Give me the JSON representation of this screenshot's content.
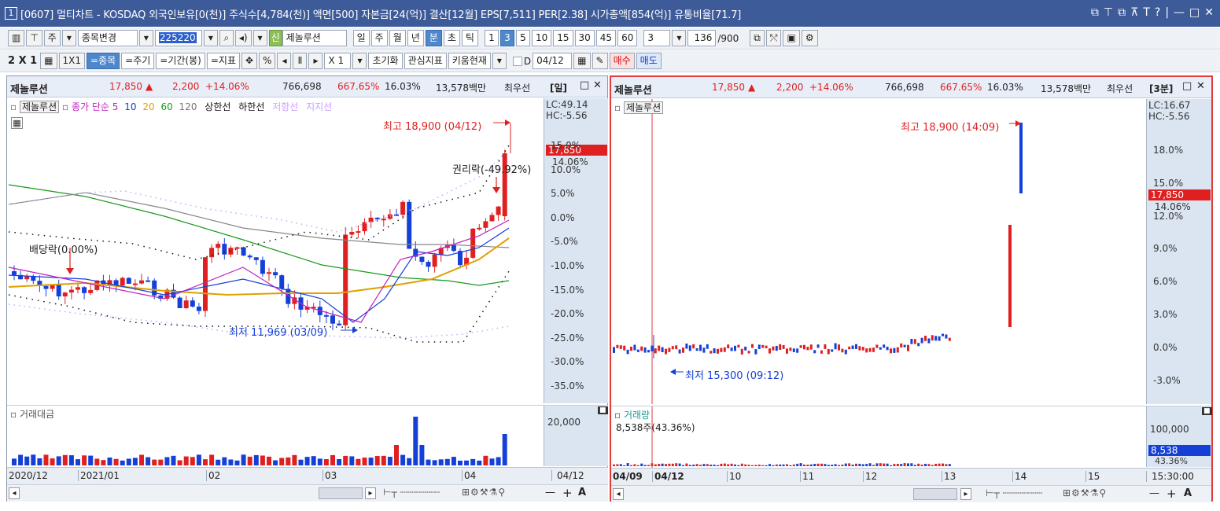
{
  "window": {
    "num": "1",
    "title": "[0607] 멀티차트 - KOSDAQ 외국인보유[0(천)] 주식수[4,784(천)] 액면[500] 자본금[24(억)] 결산[12월] EPS[7,511] PER[2.38] 시가총액[854(억)] 유통비율[71.7]",
    "controls": [
      "⧉",
      "⊤",
      "⧉",
      "⊼",
      "T",
      "?",
      "|",
      "—",
      "□",
      "✕"
    ]
  },
  "toolbar1": {
    "kind": "주",
    "change": "종목변경",
    "code": "225220",
    "stock_tag": "신",
    "stock_name": "제놀루션",
    "periods": [
      "일",
      "주",
      "월",
      "년",
      "분",
      "초",
      "틱"
    ],
    "period_selected": "분",
    "intervals": [
      "1",
      "3",
      "5",
      "10",
      "15",
      "30",
      "45",
      "60"
    ],
    "interval_selected": "3",
    "count_select": "3",
    "range": "136",
    "range_total": "/900"
  },
  "toolbar2": {
    "grid": "2 X 1",
    "one": "1X1",
    "tabs": [
      "=종목",
      "=주기",
      "=기간(봉)",
      "=지표"
    ],
    "tab_selected": "=종목",
    "pct": "%",
    "mult": "X 1",
    "reset": "초기화",
    "watch": "관심지표",
    "kiwoom": "키움현재",
    "d": "D",
    "date": "04/12",
    "buy": "매수",
    "sell": "매도"
  },
  "colors": {
    "up": "#e02020",
    "down": "#1540d8",
    "accent": "#4e87cc"
  },
  "left": {
    "header": {
      "name": "제놀루션",
      "price": "17,850",
      "arrow": "▲",
      "change": "2,200",
      "pct": "+14.06%",
      "volume": "766,698",
      "vol_pct": "667.65%",
      "rate": "16.03%",
      "amount": "13,578백만",
      "ask": "최우선",
      "period": "[일]"
    },
    "legend": {
      "name": "제놀루션",
      "ma": "종가 단순",
      "p5": "5",
      "p10": "10",
      "p20": "20",
      "p60": "60",
      "p120": "120",
      "upper": "상한선",
      "lower": "하한선",
      "resist": "저항선",
      "support": "지지선"
    },
    "lc": "LC:49.14",
    "hc": "HC:-5.56",
    "yticks": [
      "15.0%",
      "10.0%",
      "5.0%",
      "0.0%",
      "-5.0%",
      "-10.0%",
      "-15.0%",
      "-20.0%",
      "-25.0%",
      "-30.0%",
      "-35.0%"
    ],
    "price_tag": "17,850",
    "pct_tag": "14.06%",
    "ann_high": "최고 18,900 (04/12)",
    "ann_low": "최저 11,969 (03/09)",
    "ann_div": "배당락(0.00%)",
    "ann_right": "권리락(-49.92%)",
    "vol_title": "거래대금",
    "vol_ytick": "20,000",
    "xlabels": [
      "2020/12",
      "2021/01",
      "02",
      "03",
      "04"
    ],
    "xright": "04/12"
  },
  "right": {
    "header": {
      "name": "제놀루션",
      "price": "17,850",
      "arrow": "▲",
      "change": "2,200",
      "pct": "+14.06%",
      "volume": "766,698",
      "vol_pct": "667.65%",
      "rate": "16.03%",
      "amount": "13,578백만",
      "ask": "최우선",
      "period": "[3분]"
    },
    "legend": {
      "name": "제놀루션"
    },
    "lc": "LC:16.67",
    "hc": "HC:-5.56",
    "yticks": [
      "18.0%",
      "15.0%",
      "12.0%",
      "9.0%",
      "6.0%",
      "3.0%",
      "0.0%",
      "-3.0%"
    ],
    "price_tag": "17,850",
    "pct_tag": "14.06%",
    "ann_high": "최고 18,900 (14:09)",
    "ann_low": "최저 15,300 (09:12)",
    "vol_title": "거래량",
    "vol_value": "8,538주(43.36%)",
    "vol_ytick": "100,000",
    "vol_tag": "8,538",
    "vol_tag_pct": "43.36%",
    "xlabels": [
      "04/09",
      "04/12",
      "10",
      "11",
      "12",
      "13",
      "14",
      "15"
    ],
    "xright": "15:30:00"
  }
}
